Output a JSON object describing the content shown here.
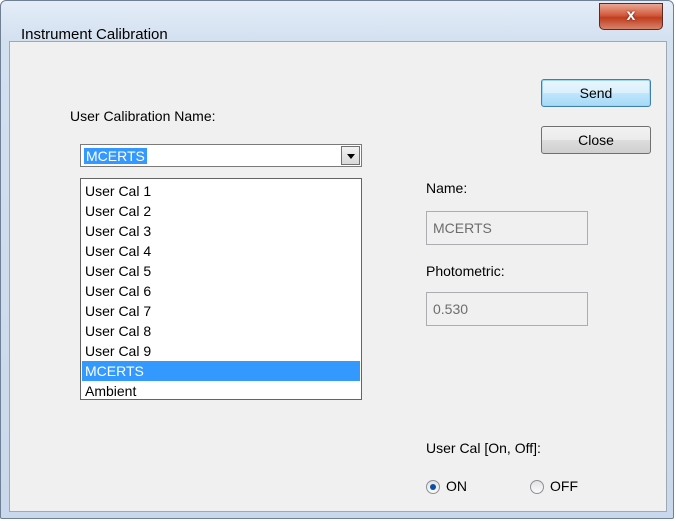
{
  "window": {
    "title": "Instrument Calibration",
    "close_glyph": "x"
  },
  "buttons": {
    "send": "Send",
    "close": "Close"
  },
  "user_calibration": {
    "label": "User Calibration Name:",
    "selected": "MCERTS",
    "options": [
      "User Cal 1",
      "User Cal 2",
      "User Cal 3",
      "User Cal 4",
      "User Cal 5",
      "User Cal 6",
      "User Cal 7",
      "User Cal 8",
      "User Cal 9",
      "MCERTS",
      "Ambient"
    ],
    "highlighted_index": 9
  },
  "name_field": {
    "label": "Name:",
    "value": "MCERTS"
  },
  "photometric_field": {
    "label": "Photometric:",
    "value": "0.530"
  },
  "user_cal_toggle": {
    "label": "User Cal [On, Off]:",
    "on_label": "ON",
    "off_label": "OFF",
    "selected": "ON"
  },
  "colors": {
    "selection": "#3399ff",
    "title_bar": "#d3e0f0",
    "close_button": "#c9482b"
  },
  "icons": {
    "close": "close-icon",
    "dropdown": "chevron-down-icon"
  }
}
